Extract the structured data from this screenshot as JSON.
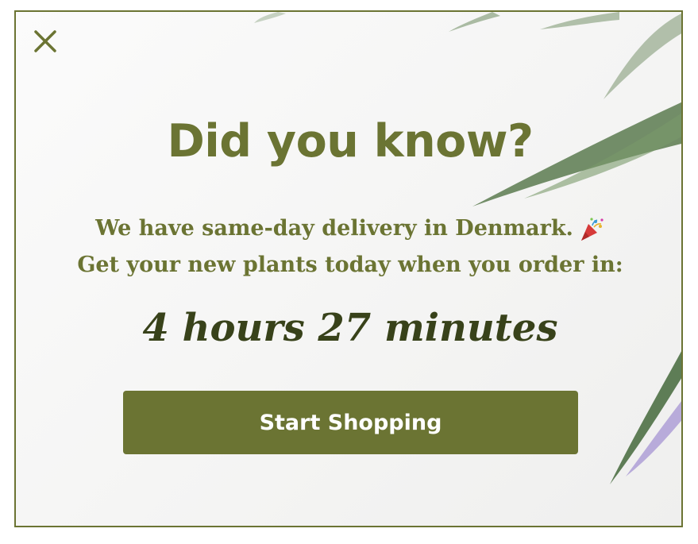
{
  "popup": {
    "close_icon": "close-icon",
    "headline": "Did you know?",
    "message_line_1": "We have same-day delivery in Denmark.",
    "message_emoji": "party-popper-icon",
    "message_line_2": "Get your new plants today when you order in:",
    "countdown": "4 hours 27 minutes",
    "cta_label": "Start Shopping"
  },
  "colors": {
    "brand_green": "#6b7433",
    "countdown_text": "#38421a",
    "button_text": "#ffffff",
    "border": "#6b7433"
  }
}
